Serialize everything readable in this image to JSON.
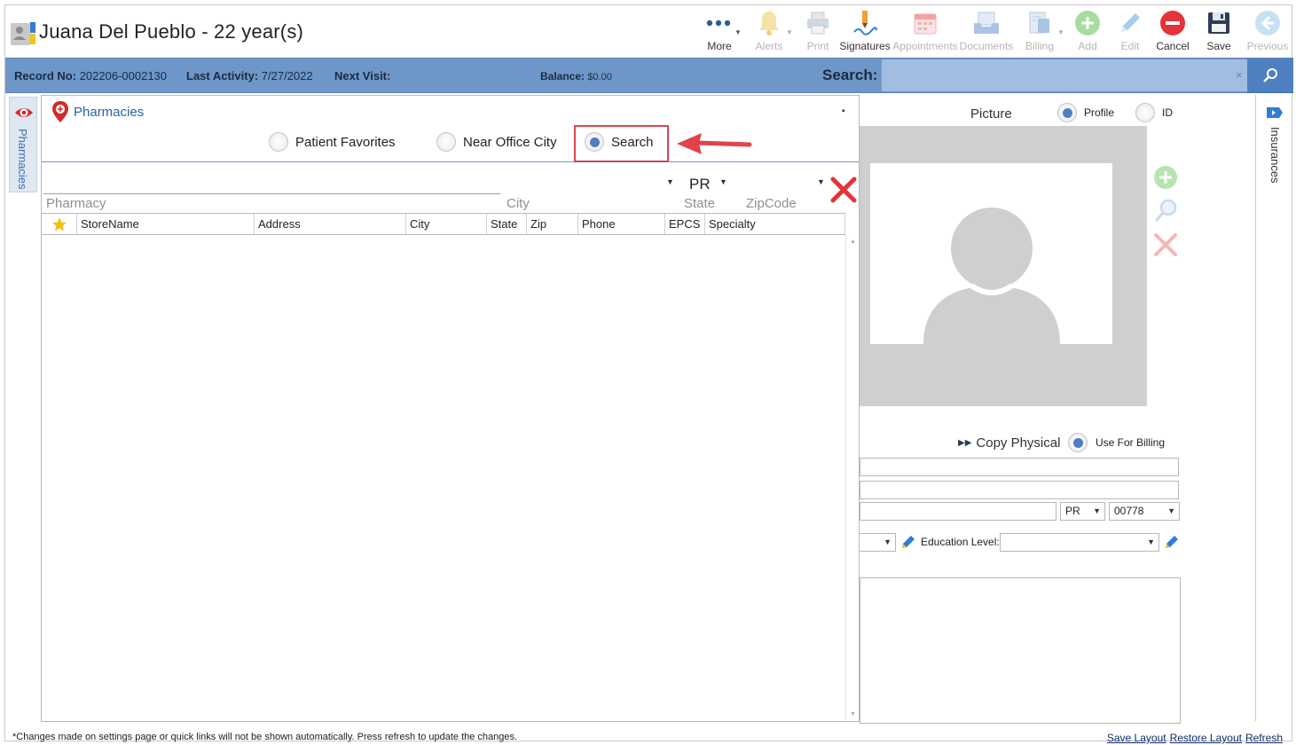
{
  "header": {
    "patient_name": "Juana Del Pueblo - 22 year(s)",
    "toolbar": [
      {
        "key": "more",
        "label": "More",
        "icon": "more-dots-icon",
        "enabled": true,
        "dropdown": true
      },
      {
        "key": "alerts",
        "label": "Alerts",
        "icon": "bell-icon",
        "enabled": false,
        "dropdown": true
      },
      {
        "key": "print",
        "label": "Print",
        "icon": "printer-icon",
        "enabled": false,
        "dropdown": false
      },
      {
        "key": "signatures",
        "label": "Signatures",
        "icon": "signature-pen-icon",
        "enabled": true,
        "dropdown": false
      },
      {
        "key": "appointments",
        "label": "Appointments",
        "icon": "calendar-icon",
        "enabled": false,
        "dropdown": false
      },
      {
        "key": "documents",
        "label": "Documents",
        "icon": "documents-tray-icon",
        "enabled": false,
        "dropdown": false
      },
      {
        "key": "billing",
        "label": "Billing",
        "icon": "billing-icon",
        "enabled": false,
        "dropdown": true
      },
      {
        "key": "add",
        "label": "Add",
        "icon": "add-icon",
        "enabled": false,
        "dropdown": false
      },
      {
        "key": "edit",
        "label": "Edit",
        "icon": "pencil-icon",
        "enabled": false,
        "dropdown": false
      },
      {
        "key": "cancel",
        "label": "Cancel",
        "icon": "cancel-icon",
        "enabled": true,
        "dropdown": false
      },
      {
        "key": "save",
        "label": "Save",
        "icon": "floppy-disk-icon",
        "enabled": true,
        "dropdown": false
      },
      {
        "key": "previous",
        "label": "Previous",
        "icon": "back-arrow-icon",
        "enabled": false,
        "dropdown": false
      }
    ]
  },
  "record_bar": {
    "record_no_label": "Record No:",
    "record_no": "202206-0002130",
    "last_activity_label": "Last Activity:",
    "last_activity": "7/27/2022",
    "next_visit_label": "Next Visit:",
    "next_visit": "",
    "balance_label": "Balance:",
    "balance": "$0.00",
    "search_label": "Search:",
    "search_value": "",
    "clear_glyph": "×"
  },
  "left_tab": {
    "label": "Pharmacies"
  },
  "right_tab": {
    "label": "Insurances"
  },
  "pharmacies": {
    "title": "Pharmacies",
    "pin_glyph": "▪",
    "modes": [
      {
        "label": "Patient Favorites",
        "selected": false
      },
      {
        "label": "Near Office City",
        "selected": false
      },
      {
        "label": "Search",
        "selected": true
      }
    ],
    "filters": {
      "pharmacy_placeholder": "Pharmacy",
      "city_placeholder": "City",
      "state_value": "PR",
      "state_label": "State",
      "zip_placeholder": "ZipCode"
    },
    "columns": [
      "StoreName",
      "Address",
      "City",
      "State",
      "Zip",
      "Phone",
      "EPCS",
      "Specialty"
    ],
    "rows": []
  },
  "picture": {
    "title": "Picture",
    "options": [
      {
        "label": "Profile",
        "selected": true
      },
      {
        "label": "ID",
        "selected": false
      }
    ]
  },
  "address": {
    "copy_physical": "Copy Physical",
    "use_for_billing": "Use For Billing",
    "use_for_billing_selected": true,
    "line1": "",
    "line2": "",
    "city": "",
    "state": "PR",
    "zip": "00778",
    "education_level_label": "Education Level:",
    "education_level": ""
  },
  "footer": {
    "note": "*Changes made on settings page or quick links will not be shown automatically. Press refresh to update the changes.",
    "save_layout": "Save Layout",
    "restore_layout": "Restore Layout",
    "refresh": "Refresh"
  },
  "colors": {
    "record_bar": "#6e97c9",
    "search_field": "#a2bde2",
    "accent_blue": "#4f7fc0",
    "highlight_red": "#e0444a"
  }
}
